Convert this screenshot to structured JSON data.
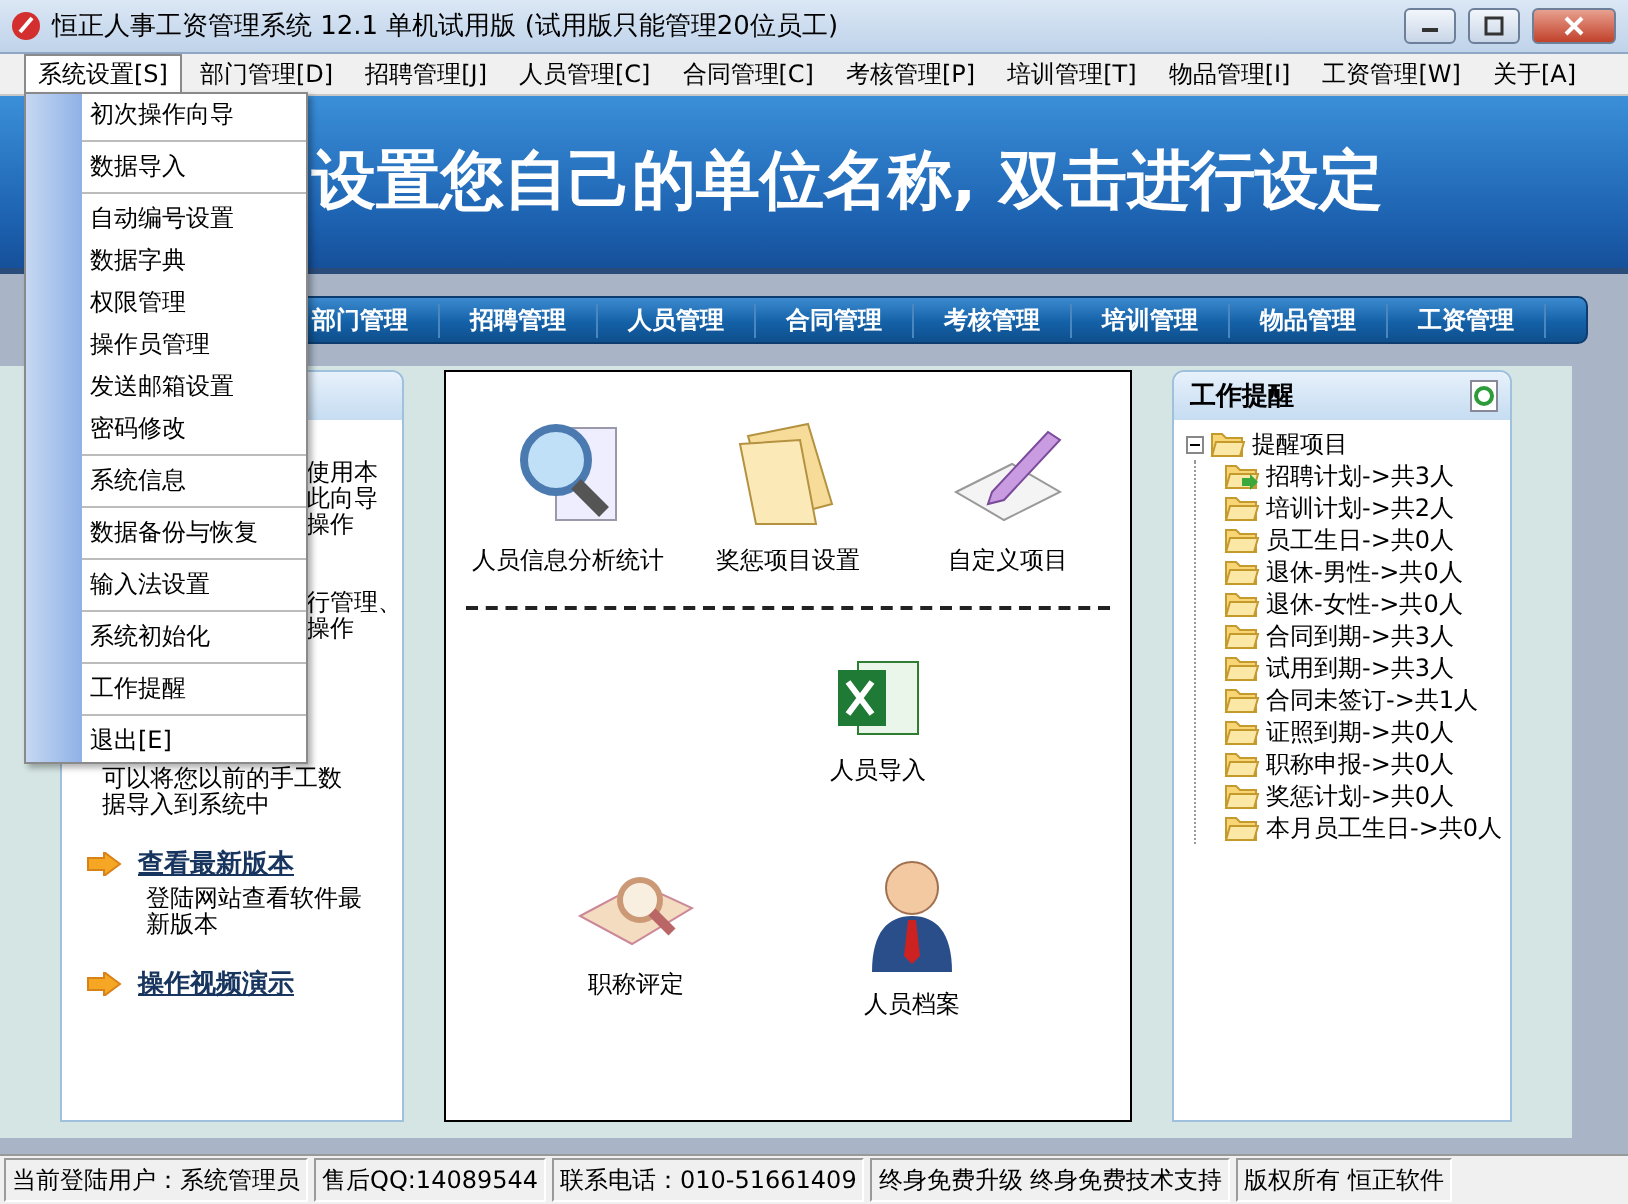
{
  "window": {
    "title": "恒正人事工资管理系统 12.1 单机试用版 (试用版只能管理20位员工)"
  },
  "menubar": [
    {
      "label": "系统设置[S]",
      "selected": true
    },
    {
      "label": "部门管理[D]",
      "selected": false
    },
    {
      "label": "招聘管理[J]",
      "selected": false
    },
    {
      "label": "人员管理[C]",
      "selected": false
    },
    {
      "label": "合同管理[C]",
      "selected": false
    },
    {
      "label": "考核管理[P]",
      "selected": false
    },
    {
      "label": "培训管理[T]",
      "selected": false
    },
    {
      "label": "物品管理[I]",
      "selected": false
    },
    {
      "label": "工资管理[W]",
      "selected": false
    },
    {
      "label": "关于[A]",
      "selected": false
    }
  ],
  "menu": {
    "groups": [
      [
        "初次操作向导"
      ],
      [
        "数据导入"
      ],
      [
        "自动编号设置",
        "数据字典",
        "权限管理",
        "操作员管理",
        "发送邮箱设置",
        "密码修改"
      ],
      [
        "系统信息"
      ],
      [
        "数据备份与恢复"
      ],
      [
        "输入法设置"
      ],
      [
        "系统初始化"
      ],
      [
        "工作提醒"
      ],
      [
        "退出[E]"
      ]
    ]
  },
  "banner": {
    "text": "设置您自己的单位名称, 双击进行设定"
  },
  "nav": [
    "部门管理",
    "招聘管理",
    "人员管理",
    "合同管理",
    "考核管理",
    "培训管理",
    "物品管理",
    "工资管理"
  ],
  "left_panel": {
    "fragments": [
      [
        "使用本",
        "此向导",
        "操作"
      ],
      [
        "行管理、",
        "操作"
      ],
      [
        "可以将您以前的手工数",
        "据导入到系统中"
      ]
    ],
    "links": [
      {
        "label": "查看最新版本",
        "description": "登陆网站查看软件最新版本"
      },
      {
        "label": "操作视频演示"
      }
    ]
  },
  "center_panel": {
    "top": [
      {
        "label": "人员信息分析统计",
        "kind": "magnifier"
      },
      {
        "label": "奖惩项目设置",
        "kind": "papers"
      },
      {
        "label": "自定义项目",
        "kind": "pencil"
      }
    ],
    "middle": [
      {
        "label": "人员导入",
        "kind": "excel"
      }
    ],
    "bottom": [
      {
        "label": "职称评定",
        "kind": "search"
      },
      {
        "label": "人员档案",
        "kind": "person"
      }
    ]
  },
  "reminder": {
    "title": "工作提醒",
    "root": {
      "label": "提醒项目",
      "expanded": true,
      "children": [
        {
          "label": "招聘计划->共3人",
          "marked": true
        },
        {
          "label": "培训计划->共2人",
          "marked": false
        },
        {
          "label": "员工生日->共0人",
          "marked": false
        },
        {
          "label": "退休-男性->共0人",
          "marked": false
        },
        {
          "label": "退休-女性->共0人",
          "marked": false
        },
        {
          "label": "合同到期->共3人",
          "marked": false
        },
        {
          "label": "试用到期->共3人",
          "marked": false
        },
        {
          "label": "合同未签订->共1人",
          "marked": false
        },
        {
          "label": "证照到期->共0人",
          "marked": false
        },
        {
          "label": "职称申报->共0人",
          "marked": false
        },
        {
          "label": "奖惩计划->共0人",
          "marked": false
        },
        {
          "label": "本月员工生日->共0人",
          "marked": false
        }
      ]
    }
  },
  "status_bar": [
    "当前登陆用户：系统管理员",
    "售后QQ:14089544",
    "联系电话：010-51661409",
    "终身免费升级 终身免费技术支持",
    "版权所有 恒正软件"
  ]
}
